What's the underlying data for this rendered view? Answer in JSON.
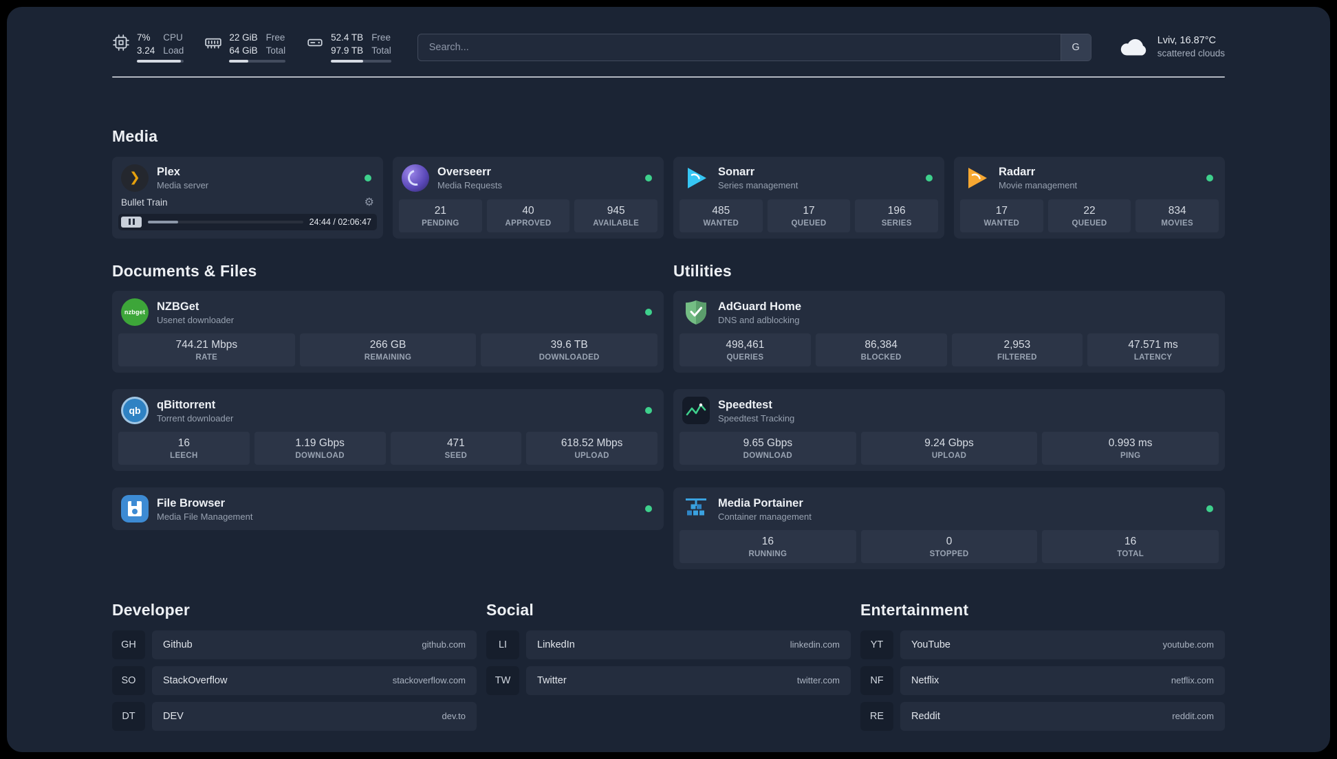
{
  "topbar": {
    "cpu": {
      "line1": "7%",
      "line2": "3.24",
      "label1": "CPU",
      "label2": "Load",
      "bar_pct": 93
    },
    "memory": {
      "line1": "22 GiB",
      "line2": "64 GiB",
      "label1": "Free",
      "label2": "Total",
      "bar_pct": 34
    },
    "disk": {
      "line1": "52.4 TB",
      "line2": "97.9 TB",
      "label1": "Free",
      "label2": "Total",
      "bar_pct": 54
    },
    "search": {
      "placeholder": "Search...",
      "button_label": "G"
    },
    "weather": {
      "location": "Lviv, 16.87°C",
      "condition": "scattered clouds"
    }
  },
  "media": {
    "title": "Media",
    "plex": {
      "name": "Plex",
      "desc": "Media server",
      "now_playing": "Bullet Train",
      "time": "24:44 / 02:06:47",
      "progress_pct": 19.5
    },
    "overseerr": {
      "name": "Overseerr",
      "desc": "Media Requests",
      "stats": [
        {
          "value": "21",
          "label": "PENDING"
        },
        {
          "value": "40",
          "label": "APPROVED"
        },
        {
          "value": "945",
          "label": "AVAILABLE"
        }
      ]
    },
    "sonarr": {
      "name": "Sonarr",
      "desc": "Series management",
      "stats": [
        {
          "value": "485",
          "label": "WANTED"
        },
        {
          "value": "17",
          "label": "QUEUED"
        },
        {
          "value": "196",
          "label": "SERIES"
        }
      ]
    },
    "radarr": {
      "name": "Radarr",
      "desc": "Movie management",
      "stats": [
        {
          "value": "17",
          "label": "WANTED"
        },
        {
          "value": "22",
          "label": "QUEUED"
        },
        {
          "value": "834",
          "label": "MOVIES"
        }
      ]
    }
  },
  "documents": {
    "title": "Documents & Files",
    "nzbget": {
      "name": "NZBGet",
      "desc": "Usenet downloader",
      "stats": [
        {
          "value": "744.21 Mbps",
          "label": "RATE"
        },
        {
          "value": "266 GB",
          "label": "REMAINING"
        },
        {
          "value": "39.6 TB",
          "label": "DOWNLOADED"
        }
      ]
    },
    "qbittorrent": {
      "name": "qBittorrent",
      "desc": "Torrent downloader",
      "stats": [
        {
          "value": "16",
          "label": "LEECH"
        },
        {
          "value": "1.19 Gbps",
          "label": "DOWNLOAD"
        },
        {
          "value": "471",
          "label": "SEED"
        },
        {
          "value": "618.52 Mbps",
          "label": "UPLOAD"
        }
      ]
    },
    "filebrowser": {
      "name": "File Browser",
      "desc": "Media File Management"
    }
  },
  "utilities": {
    "title": "Utilities",
    "adguard": {
      "name": "AdGuard Home",
      "desc": "DNS and adblocking",
      "stats": [
        {
          "value": "498,461",
          "label": "QUERIES"
        },
        {
          "value": "86,384",
          "label": "BLOCKED"
        },
        {
          "value": "2,953",
          "label": "FILTERED"
        },
        {
          "value": "47.571 ms",
          "label": "LATENCY"
        }
      ]
    },
    "speedtest": {
      "name": "Speedtest",
      "desc": "Speedtest Tracking",
      "stats": [
        {
          "value": "9.65 Gbps",
          "label": "DOWNLOAD"
        },
        {
          "value": "9.24 Gbps",
          "label": "UPLOAD"
        },
        {
          "value": "0.993 ms",
          "label": "PING"
        }
      ]
    },
    "portainer": {
      "name": "Media Portainer",
      "desc": "Container management",
      "stats": [
        {
          "value": "16",
          "label": "RUNNING"
        },
        {
          "value": "0",
          "label": "STOPPED"
        },
        {
          "value": "16",
          "label": "TOTAL"
        }
      ]
    }
  },
  "bookmarks": {
    "developer": {
      "title": "Developer",
      "items": [
        {
          "abbr": "GH",
          "name": "Github",
          "domain": "github.com"
        },
        {
          "abbr": "SO",
          "name": "StackOverflow",
          "domain": "stackoverflow.com"
        },
        {
          "abbr": "DT",
          "name": "DEV",
          "domain": "dev.to"
        }
      ]
    },
    "social": {
      "title": "Social",
      "items": [
        {
          "abbr": "LI",
          "name": "LinkedIn",
          "domain": "linkedin.com"
        },
        {
          "abbr": "TW",
          "name": "Twitter",
          "domain": "twitter.com"
        }
      ]
    },
    "entertainment": {
      "title": "Entertainment",
      "items": [
        {
          "abbr": "YT",
          "name": "YouTube",
          "domain": "youtube.com"
        },
        {
          "abbr": "NF",
          "name": "Netflix",
          "domain": "netflix.com"
        },
        {
          "abbr": "RE",
          "name": "Reddit",
          "domain": "reddit.com"
        }
      ]
    }
  },
  "icons": {
    "plex_glyph": "❯",
    "nzbget_glyph": "nzbget",
    "qbittorrent_glyph": "qb",
    "gear_glyph": "⚙"
  },
  "colors": {
    "status_online": "#3ed08c",
    "accent_plex": "#e5a00d"
  }
}
